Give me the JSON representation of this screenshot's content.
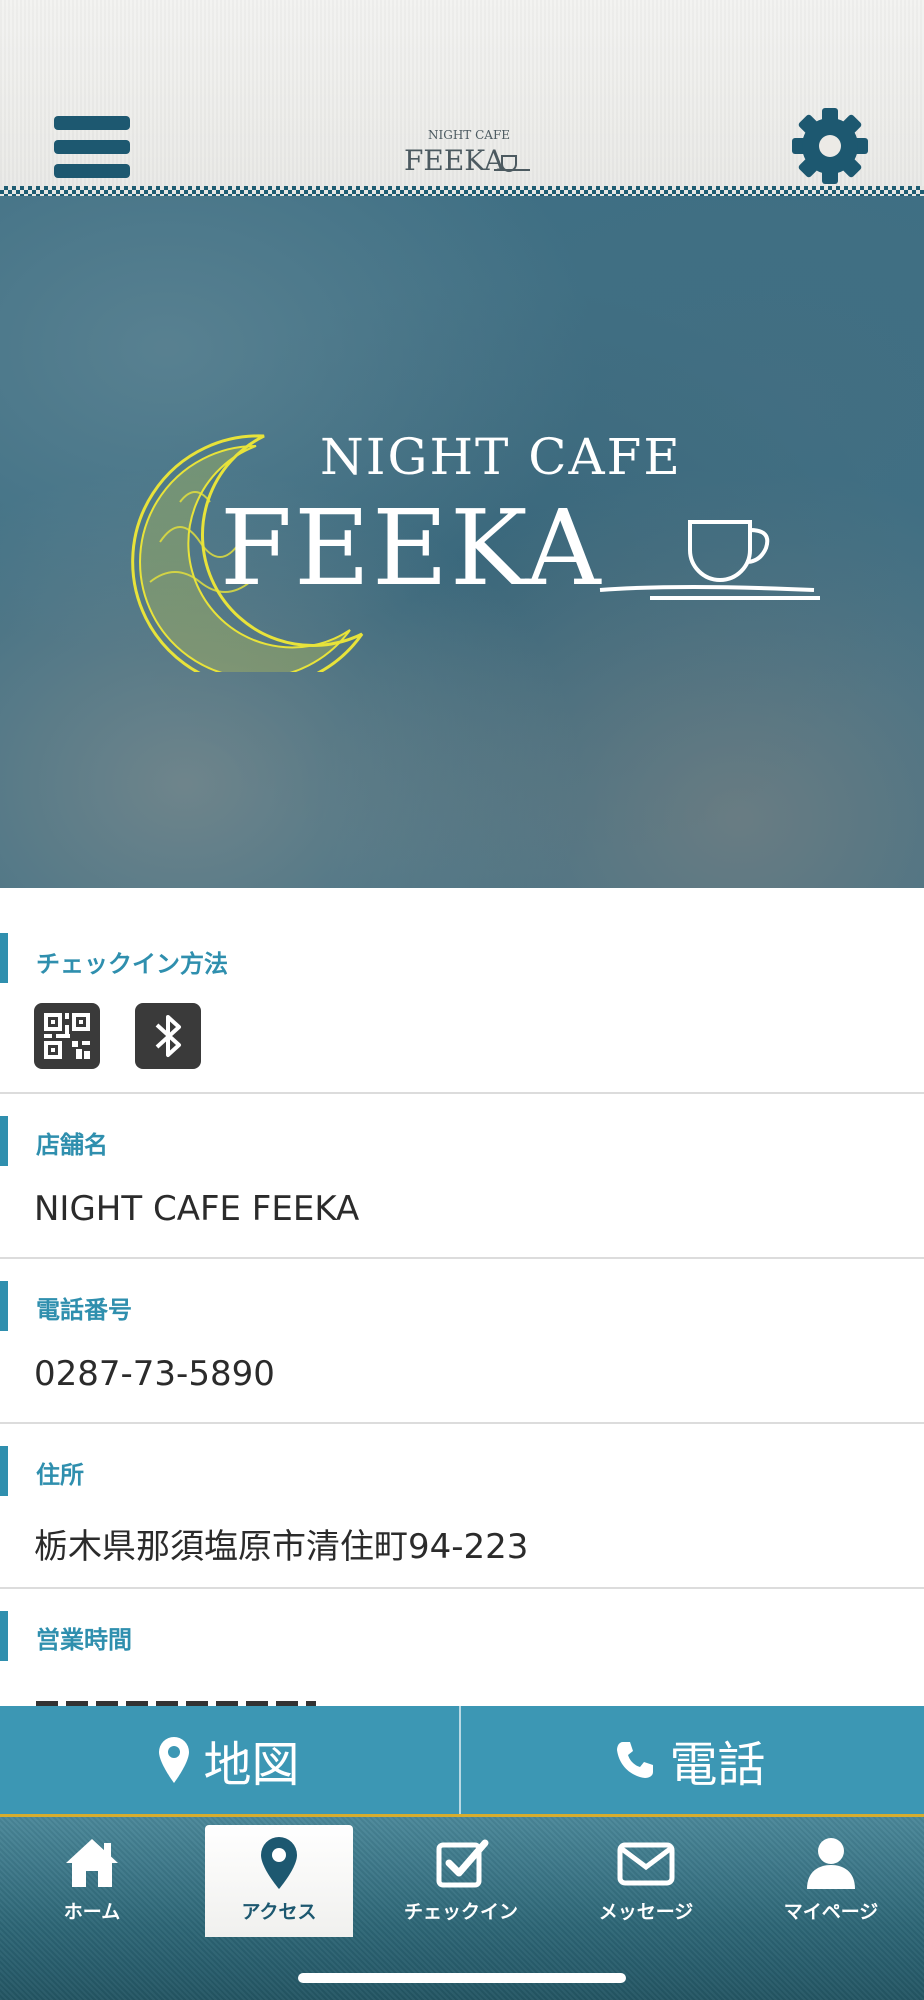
{
  "header": {
    "logo_small": "NIGHT CAFE",
    "logo_brand": "FEEKA"
  },
  "hero": {
    "logo_small": "NIGHT CAFE",
    "logo_brand": "FEEKA"
  },
  "sections": {
    "checkin": {
      "label": "チェックイン方法",
      "icons": [
        "qr-code-icon",
        "bluetooth-icon"
      ]
    },
    "store_name": {
      "label": "店舗名",
      "value": "NIGHT CAFE FEEKA"
    },
    "phone": {
      "label": "電話番号",
      "value": "0287-73-5890"
    },
    "address": {
      "label": "住所",
      "value": "栃木県那須塩原市清住町94-223"
    },
    "hours": {
      "label": "営業時間"
    }
  },
  "actions": {
    "map_label": "地図",
    "call_label": "電話"
  },
  "tabs": [
    {
      "label": "ホーム",
      "icon": "home-icon"
    },
    {
      "label": "アクセス",
      "icon": "map-pin-icon"
    },
    {
      "label": "チェックイン",
      "icon": "checkbox-icon"
    },
    {
      "label": "メッセージ",
      "icon": "mail-icon"
    },
    {
      "label": "マイページ",
      "icon": "user-icon"
    }
  ],
  "active_tab": "アクセス",
  "colors": {
    "accent": "#2f8fae",
    "header_icon": "#1d5870",
    "action_bar": "#3c97b4",
    "tab_bar_border": "#d6ad2e",
    "moon": "#e8e33a"
  }
}
